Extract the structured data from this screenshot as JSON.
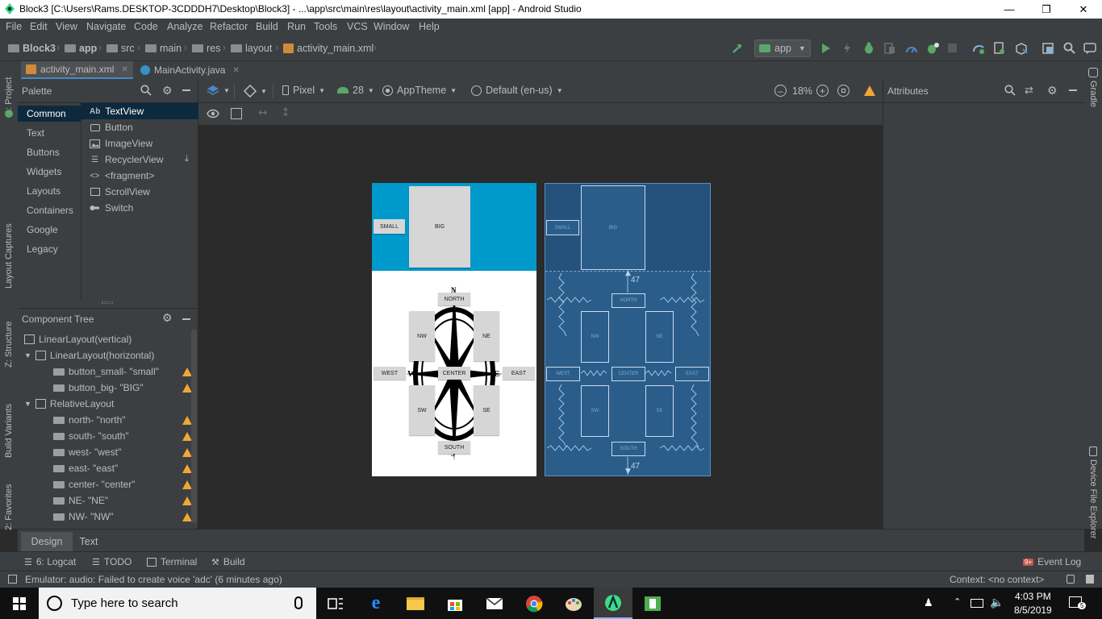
{
  "window": {
    "title": "Block3 [C:\\Users\\Rams.DESKTOP-3CDDDH7\\Desktop\\Block3] - ...\\app\\src\\main\\res\\layout\\activity_main.xml [app] - Android Studio"
  },
  "menu": [
    "File",
    "Edit",
    "View",
    "Navigate",
    "Code",
    "Analyze",
    "Refactor",
    "Build",
    "Run",
    "Tools",
    "VCS",
    "Window",
    "Help"
  ],
  "breadcrumbs": [
    "Block3",
    "app",
    "src",
    "main",
    "res",
    "layout",
    "activity_main.xml"
  ],
  "run_config": "app",
  "editor_tabs": [
    {
      "label": "activity_main.xml",
      "active": true
    },
    {
      "label": "MainActivity.java",
      "active": false
    }
  ],
  "left_strip": [
    "1: Project",
    "Layout Captures",
    "Z: Structure",
    "Build Variants",
    "2: Favorites"
  ],
  "right_strip": [
    "Gradle",
    "Device File Explorer"
  ],
  "palette": {
    "title": "Palette",
    "categories": [
      "Common",
      "Text",
      "Buttons",
      "Widgets",
      "Layouts",
      "Containers",
      "Google",
      "Legacy"
    ],
    "widgets": [
      "TextView",
      "Button",
      "ImageView",
      "RecyclerView",
      "<fragment>",
      "ScrollView",
      "Switch"
    ],
    "textview_prefix": "Ab"
  },
  "component_tree": {
    "title": "Component Tree",
    "nodes": [
      {
        "label": "LinearLayout(vertical)",
        "warn": false
      },
      {
        "label": "LinearLayout(horizontal)",
        "warn": false
      },
      {
        "label": "button_small- \"small\"",
        "warn": true
      },
      {
        "label": "button_big- \"BIG\"",
        "warn": true
      },
      {
        "label": "RelativeLayout",
        "warn": false
      },
      {
        "label": "north- \"north\"",
        "warn": true
      },
      {
        "label": "south- \"south\"",
        "warn": true
      },
      {
        "label": "west- \"west\"",
        "warn": true
      },
      {
        "label": "east- \"east\"",
        "warn": true
      },
      {
        "label": "center- \"center\"",
        "warn": true
      },
      {
        "label": "NE- \"NE\"",
        "warn": true
      },
      {
        "label": "NW- \"NW\"",
        "warn": true
      }
    ]
  },
  "design_toolbar": {
    "device": "Pixel",
    "api": "28",
    "theme": "AppTheme",
    "locale": "Default (en-us)",
    "zoom": "18%"
  },
  "attributes": {
    "title": "Attributes"
  },
  "preview": {
    "buttons": {
      "small": "SMALL",
      "big": "BIG",
      "north": "NORTH",
      "south": "SOUTH",
      "west": "WEST",
      "east": "EAST",
      "center": "CENTER",
      "nw": "NW",
      "ne": "NE",
      "sw": "SW",
      "se": "SE"
    },
    "compass_letters": {
      "n": "N",
      "s": "S",
      "w": "W",
      "e": "E"
    },
    "margin_label": "47",
    "colors": {
      "top_bg": "#0099cc",
      "blueprint_bg": "#2b5d8a"
    }
  },
  "design_tabs": [
    "Design",
    "Text"
  ],
  "tool_windows": {
    "logcat": "6: Logcat",
    "todo": "TODO",
    "terminal": "Terminal",
    "build": "Build",
    "event_log": "Event Log",
    "event_badge": "9+"
  },
  "status": {
    "message": "Emulator: audio: Failed to create voice 'adc' (6 minutes ago)",
    "context": "Context: <no context>"
  },
  "taskbar": {
    "search_placeholder": "Type here to search",
    "time": "4:03 PM",
    "date": "8/5/2019",
    "notification_count": "5"
  }
}
